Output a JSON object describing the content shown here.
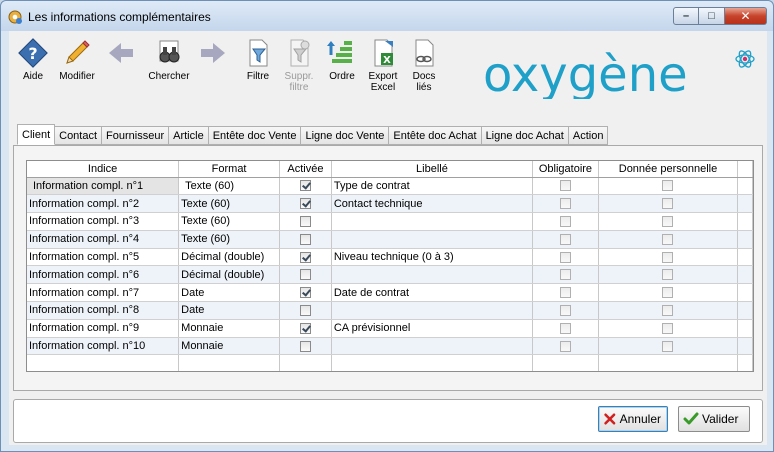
{
  "window": {
    "title": "Les informations complémentaires"
  },
  "toolbar": {
    "aide": "Aide",
    "modifier": "Modifier",
    "chercher": "Chercher",
    "filtre": "Filtre",
    "suppr_filtre_1": "Suppr.",
    "suppr_filtre_2": "filtre",
    "ordre": "Ordre",
    "export_1": "Export",
    "export_2": "Excel",
    "docs_1": "Docs",
    "docs_2": "liés"
  },
  "logo": {
    "text": "oxygène",
    "color": "#1fa0c8"
  },
  "tabs": [
    "Client",
    "Contact",
    "Fournisseur",
    "Article",
    "Entête doc Vente",
    "Ligne doc Vente",
    "Entête doc Achat",
    "Ligne doc Achat",
    "Action"
  ],
  "grid": {
    "headers": [
      "Indice",
      "Format",
      "Activée",
      "Libellé",
      "Obligatoire",
      "Donnée personnelle"
    ],
    "rows": [
      {
        "indice": "Information compl. n°1",
        "format": "Texte (60)",
        "activee": true,
        "libelle": "Type de contrat"
      },
      {
        "indice": "Information compl. n°2",
        "format": "Texte (60)",
        "activee": true,
        "libelle": "Contact technique"
      },
      {
        "indice": "Information compl. n°3",
        "format": "Texte (60)",
        "activee": false,
        "libelle": ""
      },
      {
        "indice": "Information compl. n°4",
        "format": "Texte (60)",
        "activee": false,
        "libelle": ""
      },
      {
        "indice": "Information compl. n°5",
        "format": "Décimal (double)",
        "activee": true,
        "libelle": "Niveau technique (0 à 3)"
      },
      {
        "indice": "Information compl. n°6",
        "format": "Décimal (double)",
        "activee": false,
        "libelle": ""
      },
      {
        "indice": "Information compl. n°7",
        "format": "Date",
        "activee": true,
        "libelle": "Date de contrat"
      },
      {
        "indice": "Information compl. n°8",
        "format": "Date",
        "activee": false,
        "libelle": ""
      },
      {
        "indice": "Information compl. n°9",
        "format": "Monnaie",
        "activee": true,
        "libelle": "CA prévisionnel"
      },
      {
        "indice": "Information compl. n°10",
        "format": "Monnaie",
        "activee": false,
        "libelle": ""
      }
    ]
  },
  "buttons": {
    "annuler": "Annuler",
    "valider": "Valider"
  }
}
